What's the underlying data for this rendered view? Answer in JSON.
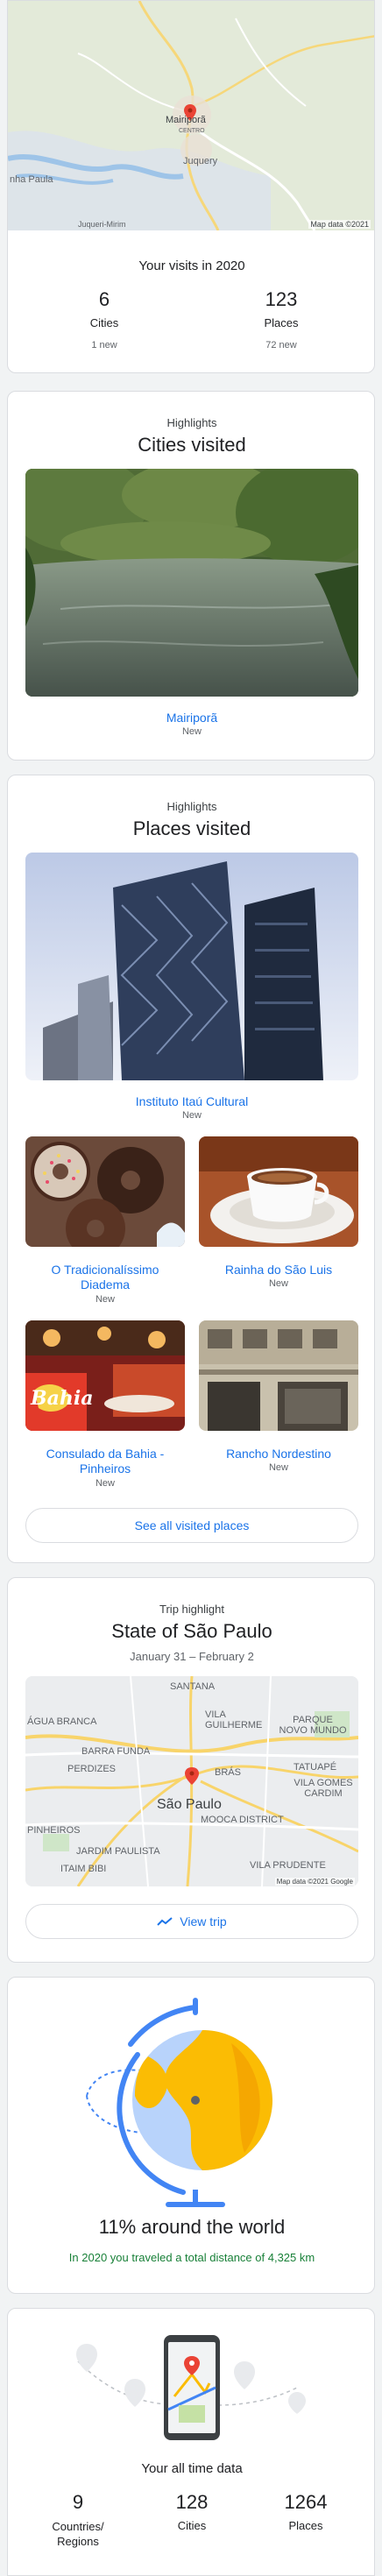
{
  "top_map": {
    "labels": {
      "city": "Mairiporã",
      "centro": "CENTRO",
      "juquery": "Juquery",
      "nha_paula": "nha Paula",
      "juqueri_mirim": "Juqueri-Mirim"
    },
    "attribution": "Map data ©2021"
  },
  "visits": {
    "title": "Your visits in 2020",
    "cities": {
      "count": "6",
      "label": "Cities",
      "sub": "1 new"
    },
    "places": {
      "count": "123",
      "label": "Places",
      "sub": "72 new"
    }
  },
  "cities_highlight": {
    "eyebrow": "Highlights",
    "title": "Cities visited",
    "name": "Mairiporã",
    "status": "New"
  },
  "places_highlight": {
    "eyebrow": "Highlights",
    "title": "Places visited",
    "items": [
      {
        "name": "Instituto Itaú Cultural",
        "status": "New"
      },
      {
        "name": "O Tradicionalíssimo Diadema",
        "status": "New"
      },
      {
        "name": "Rainha do São Luis",
        "status": "New"
      },
      {
        "name": "Consulado da Bahia - Pinheiros",
        "status": "New"
      },
      {
        "name": "Rancho Nordestino",
        "status": "New"
      }
    ],
    "see_all": "See all visited places"
  },
  "trip": {
    "eyebrow": "Trip highlight",
    "title": "State of São Paulo",
    "dates": "January 31 – February 2",
    "map_labels": {
      "santana": "SANTANA",
      "vila_guilherme": "VILA GUILHERME",
      "parque_novo_mundo": "PARQUE NOVO MUNDO",
      "agua_branca": "ÁGUA BRANCA",
      "barra_funda": "BARRA FUNDA",
      "perdizes": "PERDIZES",
      "bras": "BRÁS",
      "tatuape": "TATUAPÉ",
      "vila_gomes_cardim": "VILA GOMES CARDIM",
      "sao_paulo": "São Paulo",
      "mooca": "MOOCA DISTRICT",
      "pinheiros": "PINHEIROS",
      "jardim_paulista": "JARDIM PAULISTA",
      "itaim_bibi": "ITAIM BIBI",
      "vila_prudente": "VILA PRUDENTE"
    },
    "attribution": "Map data ©2021 Google",
    "view_trip": "View trip"
  },
  "world": {
    "title": "11% around the world",
    "subtitle": "In 2020 you traveled a total distance of 4,325 km"
  },
  "all_time": {
    "title": "Your all time data",
    "countries": {
      "count": "9",
      "label": "Countries/ Regions"
    },
    "cities": {
      "count": "128",
      "label": "Cities"
    },
    "places": {
      "count": "1264",
      "label": "Places"
    }
  },
  "colors": {
    "accent": "#1a73e8",
    "green": "#188038",
    "globe_blue": "#4285f4",
    "globe_yellow": "#fbbc04"
  }
}
